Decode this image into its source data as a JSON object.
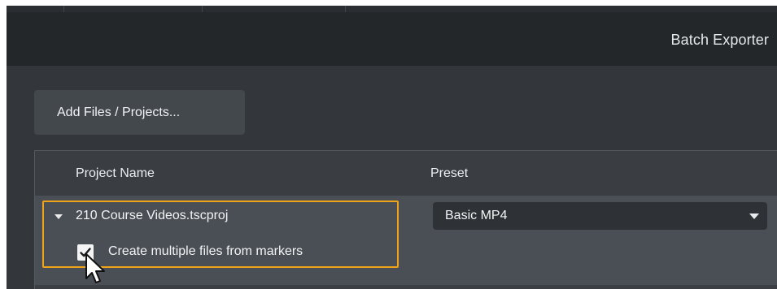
{
  "window": {
    "title": "Batch Exporter"
  },
  "toolbar": {
    "add_label": "Add Files / Projects..."
  },
  "table": {
    "columns": [
      "Project Name",
      "Preset"
    ],
    "rows": [
      {
        "project_name": "210 Course Videos.tscproj",
        "preset": "Basic MP4",
        "create_multiple_label": "Create multiple files from markers",
        "create_multiple_checked": true
      }
    ]
  },
  "colors": {
    "highlight": "#f0a419",
    "background": "#33373b",
    "titlebar": "#24272a"
  },
  "icons": [
    "expand-arrow-icon",
    "checkmark-icon",
    "chevron-down-icon",
    "mouse-pointer-icon"
  ]
}
